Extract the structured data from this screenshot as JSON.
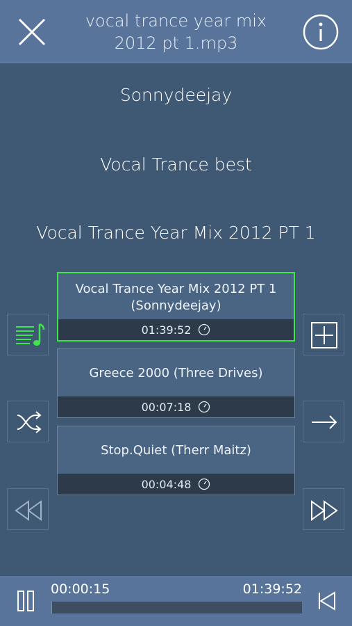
{
  "header": {
    "title_line1": "vocal trance year mix",
    "title_line2": "2012 pt 1.mp3",
    "close_icon": "close-icon",
    "info_icon": "info-icon"
  },
  "meta": {
    "artist": "Sonnydeejay",
    "album": "Vocal Trance best",
    "track": "Vocal Trance Year Mix 2012 PT 1"
  },
  "playlist": [
    {
      "title": "Vocal Trance Year Mix 2012 PT 1 (Sonnydeejay)",
      "duration": "01:39:52",
      "active": true
    },
    {
      "title": "Greece 2000 (Three Drives)",
      "duration": "00:07:18",
      "active": false
    },
    {
      "title": "Stop.Quiet (Therr Maitz)",
      "duration": "00:04:48",
      "active": false
    }
  ],
  "side_buttons": {
    "left": [
      "playlist-music-icon",
      "shuffle-icon",
      "rewind-icon"
    ],
    "right": [
      "add-icon",
      "next-arrow-icon",
      "fast-forward-icon"
    ]
  },
  "player": {
    "elapsed": "00:00:15",
    "total": "01:39:52",
    "progress_fraction": 0.0025
  },
  "colors": {
    "background": "#3f5874",
    "header": "#58749a",
    "active_border": "#3ee64a",
    "accent_green": "#3ee64a"
  }
}
